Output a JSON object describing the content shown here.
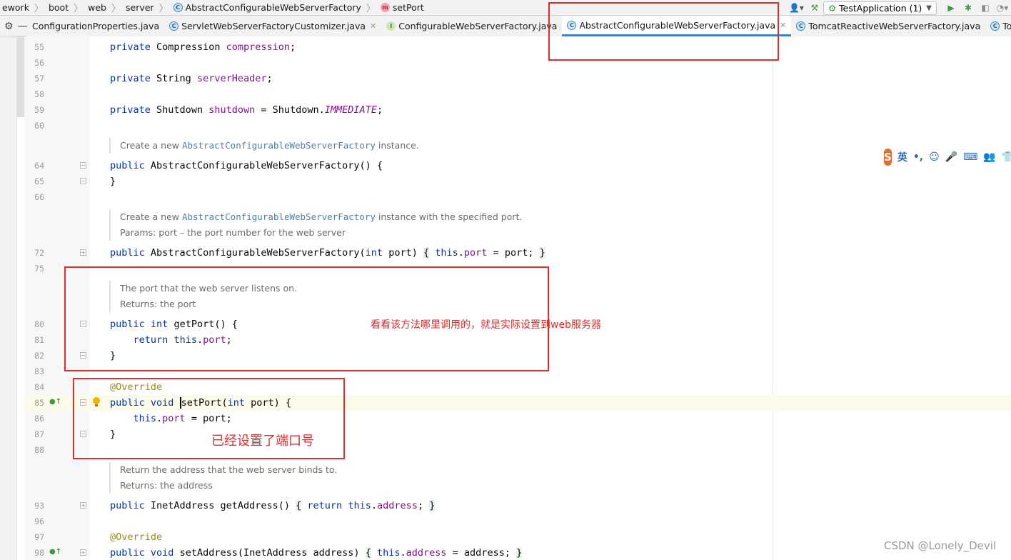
{
  "breadcrumb": {
    "items": [
      {
        "label": "ework",
        "icon": ""
      },
      {
        "label": "boot",
        "icon": ""
      },
      {
        "label": "web",
        "icon": ""
      },
      {
        "label": "server",
        "icon": ""
      },
      {
        "label": "AbstractConfigurableWebServerFactory",
        "icon": "class-icon"
      },
      {
        "label": "setPort",
        "icon": "method-icon"
      }
    ]
  },
  "toolbar": {
    "run_config": "TestApplication (1)",
    "icons": [
      "user-settings-icon",
      "build-hammer-icon",
      "run-icon",
      "debug-icon",
      "coverage-icon",
      "profile-icon"
    ]
  },
  "tabs": [
    {
      "label": "ConfigurationProperties.java",
      "icon": "",
      "active": false
    },
    {
      "label": "ServletWebServerFactoryCustomizer.java",
      "icon": "class-icon",
      "active": false
    },
    {
      "label": "ConfigurableWebServerFactory.java",
      "icon": "interface-icon",
      "active": false
    },
    {
      "label": "AbstractConfigurableWebServerFactory.java",
      "icon": "abstract-class-icon",
      "active": true
    },
    {
      "label": "TomcatReactiveWebServerFactory.java",
      "icon": "class-icon",
      "active": false
    },
    {
      "label": "Tomca",
      "icon": "class-icon",
      "active": false
    }
  ],
  "lines": {
    "l55": "55",
    "l56": "56",
    "l57": "57",
    "l58": "58",
    "l59": "59",
    "l60": "60",
    "l64": "64",
    "l65": "65",
    "l66": "66",
    "l72": "72",
    "l75": "75",
    "l80": "80",
    "l81": "81",
    "l82": "82",
    "l83": "83",
    "l84": "84",
    "l85": "85",
    "l86": "86",
    "l87": "87",
    "l88": "88",
    "l93": "93",
    "l96": "96",
    "l97": "97",
    "l98": "98"
  },
  "code": {
    "l55": [
      "private",
      "Compression",
      "compression",
      ";"
    ],
    "l57": [
      "private",
      "String",
      "serverHeader",
      ";"
    ],
    "l59": [
      "private",
      "Shutdown",
      "shutdown",
      "= Shutdown.",
      "IMMEDIATE",
      ";"
    ],
    "l64": [
      "public",
      "AbstractConfigurableWebServerFactory() {"
    ],
    "l65": "}",
    "l72": [
      "public",
      "AbstractConfigurableWebServerFactory(",
      "int",
      "port)",
      "{",
      "this",
      ".",
      "port",
      "= port;",
      "}"
    ],
    "l80": [
      "public",
      "int",
      "getPort() {"
    ],
    "l81": [
      "return",
      "this",
      ".",
      "port",
      ";"
    ],
    "l82": "}",
    "l84": "@Override",
    "l85": [
      "public",
      "void",
      "setPort",
      "(",
      "int",
      "port) {"
    ],
    "l86": [
      "this",
      ".",
      "port",
      "= port;"
    ],
    "l87": "}",
    "l93": [
      "public",
      "InetAddress getAddress()",
      "{",
      "return",
      "this",
      ".",
      "address",
      ";",
      "}"
    ],
    "l97": "@Override",
    "l98": [
      "public",
      "void",
      "setAddress(InetAddress address)",
      "{",
      "this",
      ".",
      "address",
      "= address;",
      "}"
    ]
  },
  "docs": {
    "d1": {
      "pre": "Create a new ",
      "ref": "AbstractConfigurableWebServerFactory",
      "post": " instance."
    },
    "d2": {
      "pre": "Create a new ",
      "ref": "AbstractConfigurableWebServerFactory",
      "post": " instance with the specified port.",
      "params": "Params: port – the port number for the web server"
    },
    "d3": {
      "line1": "The port that the web server listens on.",
      "line2": "Returns: the port"
    },
    "d4": {
      "line1": "Return the address that the web server binds to.",
      "line2": "Returns: the address"
    }
  },
  "annotations": {
    "note1": "看看该方法哪里调用的，就是实际设置到web服务器",
    "note2": "已经设置了端口号",
    "color": "#e42a2a"
  },
  "ime": {
    "mode": "英",
    "icons": [
      "sogou-logo-icon",
      "punctuation-icon",
      "emoji-icon",
      "microphone-icon",
      "keyboard-icon",
      "user-icon",
      "skin-icon"
    ]
  },
  "watermark": "CSDN @Lonely_Devil"
}
